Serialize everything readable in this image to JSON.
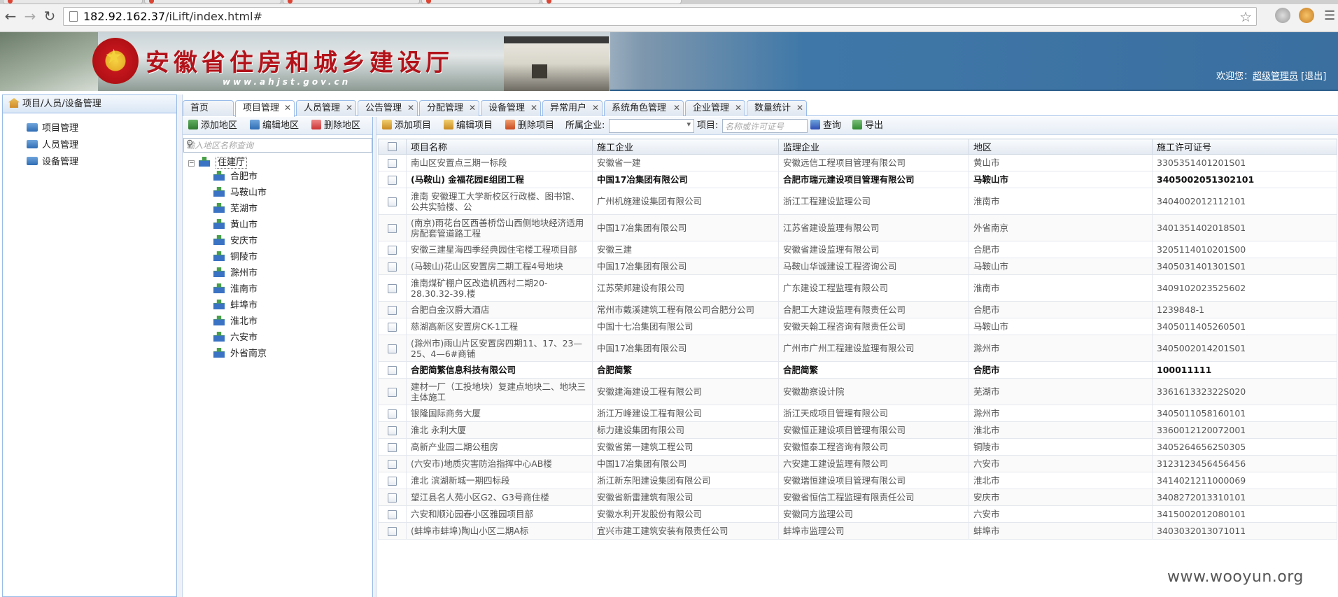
{
  "browser": {
    "url_host": "182.92.162.37",
    "url_path": "/iLift/index.html#"
  },
  "banner": {
    "title": "安徽省住房和城乡建设厅",
    "site": "www.ahjst.gov.cn",
    "welcome_prefix": "欢迎您：",
    "user_link": "超级管理员",
    "logout": "[退出]"
  },
  "left_panel": {
    "header": "项目/人员/设备管理",
    "items": [
      "项目管理",
      "人员管理",
      "设备管理"
    ]
  },
  "tabs": [
    {
      "label": "首页",
      "closable": false
    },
    {
      "label": "项目管理",
      "closable": true,
      "active": true
    },
    {
      "label": "人员管理",
      "closable": true
    },
    {
      "label": "公告管理",
      "closable": true
    },
    {
      "label": "分配管理",
      "closable": true
    },
    {
      "label": "设备管理",
      "closable": true
    },
    {
      "label": "异常用户",
      "closable": true
    },
    {
      "label": "系统角色管理",
      "closable": true
    },
    {
      "label": "企业管理",
      "closable": true
    },
    {
      "label": "数量统计",
      "closable": true
    }
  ],
  "region_toolbar": {
    "add": "添加地区",
    "edit": "编辑地区",
    "delete": "删除地区",
    "search_placeholder": "输入地区名称查询"
  },
  "tree": {
    "root": "住建厅",
    "nodes": [
      "合肥市",
      "马鞍山市",
      "芜湖市",
      "黄山市",
      "安庆市",
      "铜陵市",
      "滁州市",
      "淮南市",
      "蚌埠市",
      "淮北市",
      "六安市",
      "外省南京"
    ]
  },
  "grid_toolbar": {
    "add": "添加项目",
    "edit": "编辑项目",
    "delete": "删除项目",
    "company_label": "所属企业:",
    "project_label": "项目:",
    "project_placeholder": "名称或许可证号",
    "query": "查询",
    "export": "导出"
  },
  "grid": {
    "columns": [
      "项目名称",
      "施工企业",
      "监理企业",
      "地区",
      "施工许可证号"
    ],
    "rows": [
      {
        "name": "南山区安置点三期一标段",
        "builder": "安徽省一建",
        "supervisor": "安徽远信工程项目管理有限公司",
        "region": "黄山市",
        "permit": "3305351401201S01",
        "bold": false
      },
      {
        "name": "(马鞍山) 金福花园E组团工程",
        "builder": "中国17冶集团有限公司",
        "supervisor": "合肥市瑞元建设项目管理有限公司",
        "region": "马鞍山市",
        "permit": "3405002051302101",
        "bold": true
      },
      {
        "name": "淮南 安徽理工大学新校区行政楼、图书馆、公共实验楼、公",
        "builder": "广州机施建设集团有限公司",
        "supervisor": "浙江工程建设监理公司",
        "region": "淮南市",
        "permit": "3404002012112101",
        "bold": false
      },
      {
        "name": "(南京)雨花台区西善桥岱山西侧地块经济适用房配套管道路工程",
        "builder": "中国17冶集团有限公司",
        "supervisor": "江苏省建设监理有限公司",
        "region": "外省南京",
        "permit": "3401351402018S01",
        "bold": false
      },
      {
        "name": "安徽三建星海四季经典园住宅楼工程项目部",
        "builder": "安徽三建",
        "supervisor": "安徽省建设监理有限公司",
        "region": "合肥市",
        "permit": "3205114010201S00",
        "bold": false
      },
      {
        "name": "(马鞍山)花山区安置房二期工程4号地块",
        "builder": "中国17冶集团有限公司",
        "supervisor": "马鞍山华诚建设工程咨询公司",
        "region": "马鞍山市",
        "permit": "3405031401301S01",
        "bold": false
      },
      {
        "name": "淮南煤矿棚户区改造机西村二期20-28.30.32-39.楼",
        "builder": "江苏荣邦建设有限公司",
        "supervisor": "广东建设工程监理有限公司",
        "region": "淮南市",
        "permit": "3409102023525602",
        "bold": false
      },
      {
        "name": "合肥白金汉爵大酒店",
        "builder": "常州市戴溪建筑工程有限公司合肥分公司",
        "supervisor": "合肥工大建设监理有限责任公司",
        "region": "合肥市",
        "permit": "1239848-1",
        "bold": false
      },
      {
        "name": "慈湖高新区安置房CK-1工程",
        "builder": "中国十七冶集团有限公司",
        "supervisor": "安徽天翰工程咨询有限责任公司",
        "region": "马鞍山市",
        "permit": "3405011405260501",
        "bold": false
      },
      {
        "name": "(滁州市)雨山片区安置房四期11、17、23—25、4—6#商铺",
        "builder": "中国17冶集团有限公司",
        "supervisor": "广州市广州工程建设监理有限公司",
        "region": "滁州市",
        "permit": "3405002014201S01",
        "bold": false
      },
      {
        "name": "合肥简繁信息科技有限公司",
        "builder": "合肥简繁",
        "supervisor": "合肥简繁",
        "region": "合肥市",
        "permit": "100011111",
        "bold": true
      },
      {
        "name": "建材一厂（工投地块）复建点地块二、地块三主体施工",
        "builder": "安徽建海建设工程有限公司",
        "supervisor": "安徽勘察设计院",
        "region": "芜湖市",
        "permit": "336161332322S020",
        "bold": false
      },
      {
        "name": "银隆国际商务大厦",
        "builder": "浙江万峰建设工程有限公司",
        "supervisor": "浙江天成项目管理有限公司",
        "region": "滁州市",
        "permit": "3405011058160101",
        "bold": false
      },
      {
        "name": "淮北 永利大厦",
        "builder": "标力建设集团有限公司",
        "supervisor": "安徽恒正建设项目管理有限公司",
        "region": "淮北市",
        "permit": "3360012120072001",
        "bold": false
      },
      {
        "name": "高新产业园二期公租房",
        "builder": "安徽省第一建筑工程公司",
        "supervisor": "安徽恒泰工程咨询有限公司",
        "region": "铜陵市",
        "permit": "34052646562S0305",
        "bold": false
      },
      {
        "name": "(六安市)地质灾害防治指挥中心AB楼",
        "builder": "中国17冶集团有限公司",
        "supervisor": "六安建工建设监理有限公司",
        "region": "六安市",
        "permit": "3123123456456456",
        "bold": false
      },
      {
        "name": "淮北 滨湖新城一期四标段",
        "builder": "浙江新东阳建设集团有限公司",
        "supervisor": "安徽瑞恒建设项目管理有限公司",
        "region": "淮北市",
        "permit": "3414021211000069",
        "bold": false
      },
      {
        "name": "望江县名人苑小区G2、G3号商住楼",
        "builder": "安徽省新雷建筑有限公司",
        "supervisor": "安徽省恒信工程监理有限责任公司",
        "region": "安庆市",
        "permit": "3408272013310101",
        "bold": false
      },
      {
        "name": "六安和顺沁园春小区雅园项目部",
        "builder": "安徽水利开发股份有限公司",
        "supervisor": "安徽同方监理公司",
        "region": "六安市",
        "permit": "3415002012080101",
        "bold": false
      },
      {
        "name": "(蚌埠市蚌埠)陶山小区二期A标",
        "builder": "宜兴市建工建筑安装有限责任公司",
        "supervisor": "蚌埠市监理公司",
        "region": "蚌埠市",
        "permit": "3403032013071011",
        "bold": false
      }
    ]
  },
  "watermark": "www.wooyun.org"
}
